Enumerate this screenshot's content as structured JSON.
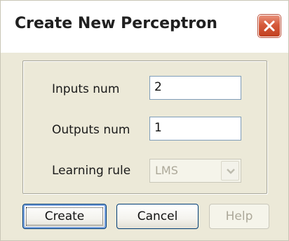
{
  "dialog": {
    "title": "Create New Perceptron"
  },
  "form": {
    "inputs_label": "Inputs num",
    "inputs_value": "2",
    "outputs_label": "Outputs num",
    "outputs_value": "1",
    "rule_label": "Learning rule",
    "rule_value": "LMS"
  },
  "buttons": {
    "create": "Create",
    "cancel": "Cancel",
    "help": "Help"
  },
  "icons": {
    "close": "close-icon",
    "dropdown": "chevron-down-icon"
  },
  "colors": {
    "window_bg": "#ece9d8",
    "close_button": "#d55a3a",
    "button_border": "#003c74",
    "disabled_text": "#aca899"
  }
}
